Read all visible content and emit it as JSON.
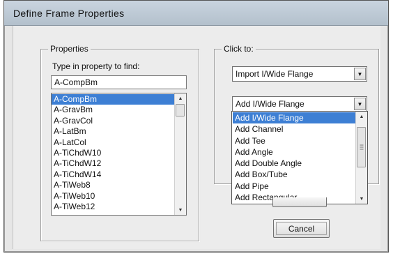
{
  "window": {
    "title": "Define Frame Properties"
  },
  "properties": {
    "group_label": "Properties",
    "find_label": "Type in property to find:",
    "find_value": "A-CompBm",
    "items": [
      "A-CompBm",
      "A-GravBm",
      "A-GravCol",
      "A-LatBm",
      "A-LatCol",
      "A-TiChdW10",
      "A-TiChdW12",
      "A-TiChdW14",
      "A-TiWeb8",
      "A-TiWeb10",
      "A-TiWeb12"
    ],
    "selected_index": 0
  },
  "click_to": {
    "group_label": "Click to:",
    "import_combo_value": "Import I/Wide Flange",
    "add_combo_value": "Add I/Wide Flange",
    "add_options": [
      "Add I/Wide Flange",
      "Add Channel",
      "Add Tee",
      "Add Angle",
      "Add Double Angle",
      "Add Box/Tube",
      "Add Pipe",
      "Add Rectangular"
    ],
    "add_selected_index": 0
  },
  "buttons": {
    "cancel": "Cancel"
  },
  "icons": {
    "combo_arrow": "chevron-down-icon",
    "scroll_up": "scroll-up-icon",
    "scroll_down": "scroll-down-icon"
  },
  "colors": {
    "selection": "#3d7fd4",
    "titlebar": "#c9d4df"
  }
}
